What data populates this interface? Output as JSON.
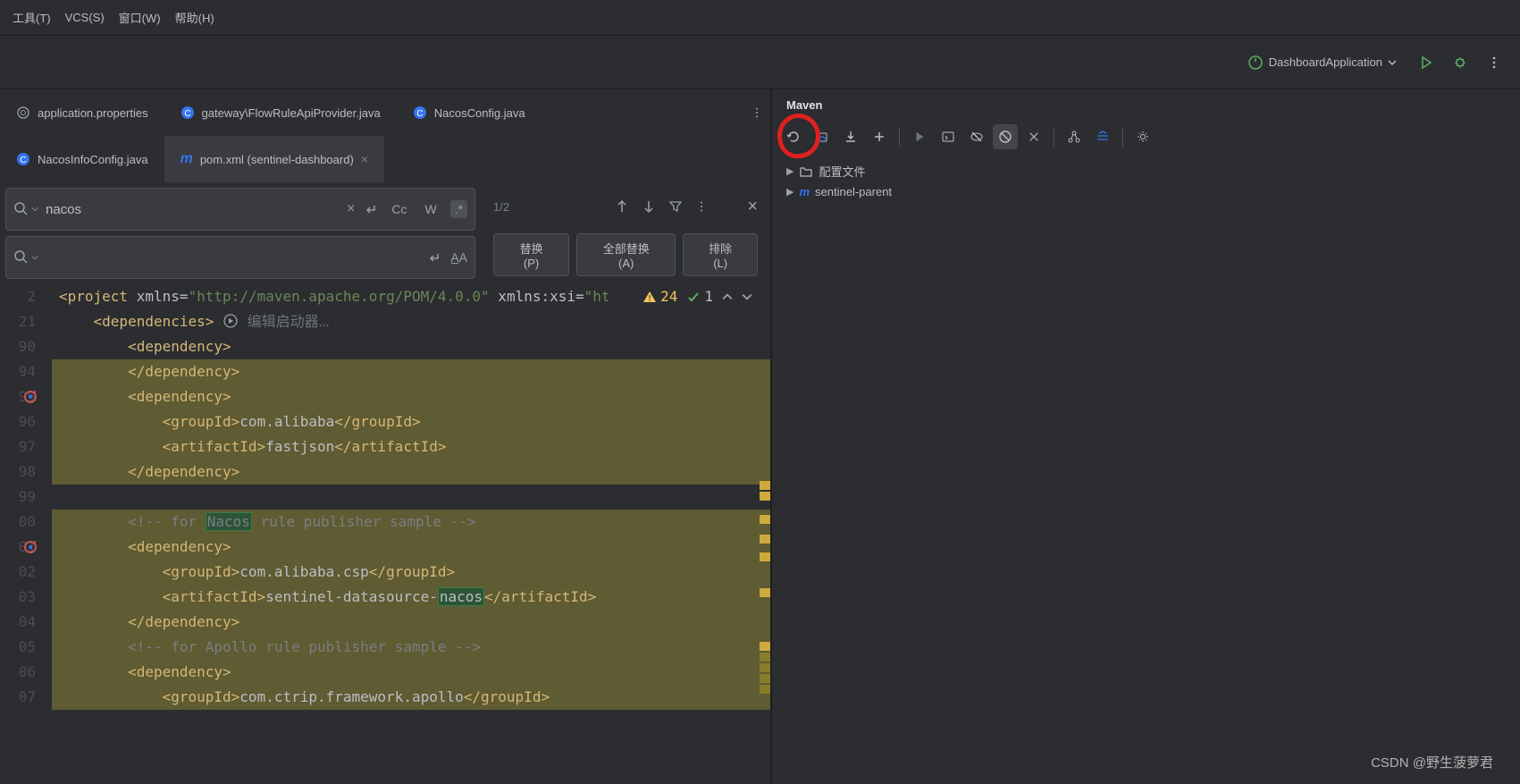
{
  "menubar": {
    "tools": "工具(T)",
    "vcs": "VCS(S)",
    "window": "窗口(W)",
    "help": "帮助(H)"
  },
  "toolbar": {
    "run_config": "DashboardApplication"
  },
  "tabs_row1": [
    {
      "label": "application.properties",
      "icon": "props"
    },
    {
      "label": "gateway\\FlowRuleApiProvider.java",
      "icon": "class"
    },
    {
      "label": "NacosConfig.java",
      "icon": "class"
    }
  ],
  "tabs_row2": [
    {
      "label": "NacosInfoConfig.java",
      "icon": "class"
    },
    {
      "label": "pom.xml (sentinel-dashboard)",
      "icon": "maven",
      "active": true
    }
  ],
  "search": {
    "find_value": "nacos",
    "count": "1/2",
    "cc": "Cc",
    "w": "W",
    "regex": ".*",
    "replace_btn": "替换(P)",
    "replace_all_btn": "全部替换(A)",
    "exclude_btn": "排除(L)"
  },
  "inspections": {
    "warn_count": "24",
    "ok_count": "1"
  },
  "inline_hint": "编辑启动器...",
  "gutter_lines": [
    "2",
    "21",
    "90",
    "94",
    "95",
    "96",
    "97",
    "98",
    "99",
    "00",
    "01",
    "02",
    "03",
    "04",
    "05",
    "06",
    "07"
  ],
  "code": {
    "l0_a": "<project ",
    "l0_b": "xmlns",
    "l0_c": "=",
    "l0_d": "\"http://maven.apache.org/POM/4.0.0\"",
    "l0_e": " xmlns:",
    "l0_f": "xsi",
    "l0_g": "=",
    "l0_h": "\"ht",
    "l1": "    <dependencies>",
    "l2": "        <dependency>",
    "l3": "        </dependency>",
    "l4": "        <dependency>",
    "l5_a": "            <groupId>",
    "l5_b": "com.alibaba",
    "l5_c": "</groupId>",
    "l6_a": "            <artifactId>",
    "l6_b": "fastjson",
    "l6_c": "</artifactId>",
    "l7": "        </dependency>",
    "l8": "",
    "l9_a": "        <!-- for ",
    "l9_b": "Nacos",
    "l9_c": " rule publisher sample -->",
    "l10": "        <dependency>",
    "l11_a": "            <groupId>",
    "l11_b": "com.alibaba.csp",
    "l11_c": "</groupId>",
    "l12_a": "            <artifactId>",
    "l12_b": "sentinel-datasource-",
    "l12_c": "nacos",
    "l12_d": "</artifactId>",
    "l13": "        </dependency>",
    "l14": "        <!-- for Apollo rule publisher sample -->",
    "l15": "        <dependency>",
    "l16_a": "            <groupId>",
    "l16_b": "com.ctrip.framework.apollo",
    "l16_c": "</groupId>"
  },
  "maven": {
    "title": "Maven",
    "tree": {
      "profiles": "配置文件",
      "project": "sentinel-parent"
    }
  },
  "watermark": "CSDN @野生菠萝君"
}
